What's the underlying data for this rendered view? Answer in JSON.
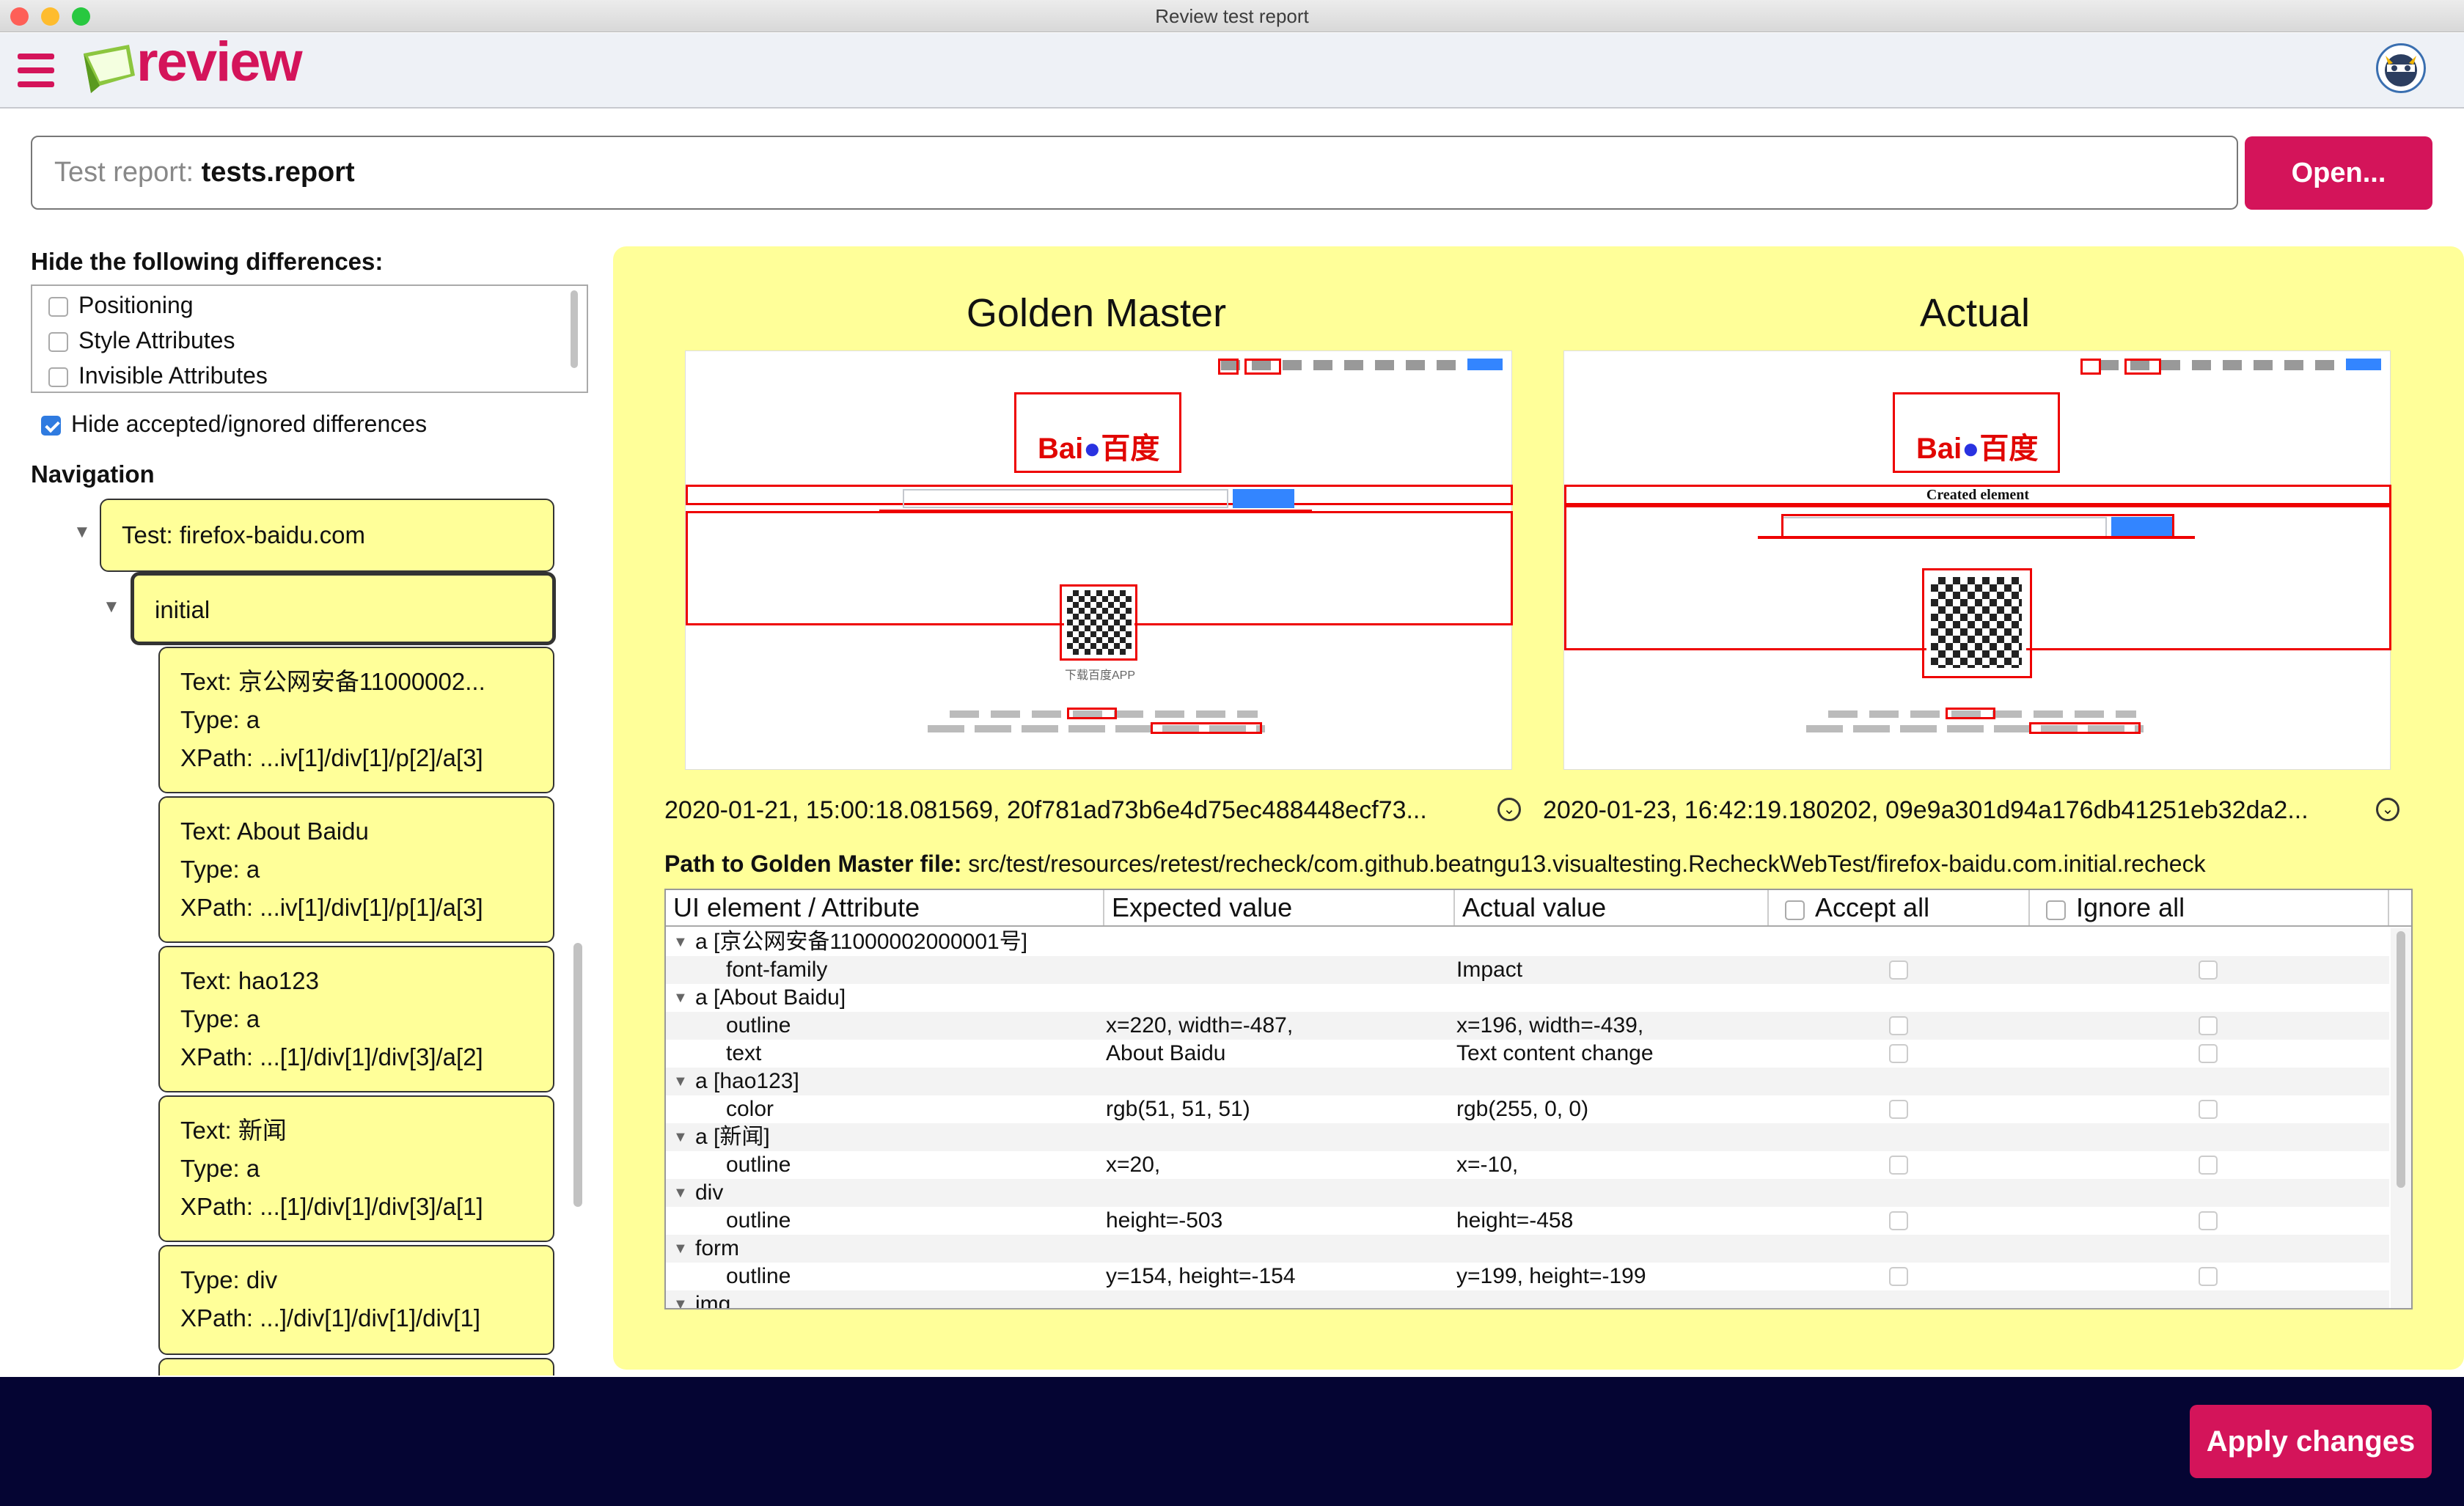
{
  "window": {
    "title": "Review test report"
  },
  "header": {
    "logo_text": "review"
  },
  "report": {
    "label": "Test report:",
    "value": "tests.report",
    "open_label": "Open..."
  },
  "filters": {
    "title": "Hide the following differences:",
    "options": [
      "Positioning",
      "Style Attributes",
      "Invisible Attributes"
    ],
    "hide_accepted_label": "Hide accepted/ignored differences",
    "hide_accepted_checked": true
  },
  "navigation": {
    "title": "Navigation",
    "test_label": "Test: firefox-baidu.com",
    "state_label": "initial",
    "items": [
      {
        "text": "Text:   京公网安备11000002...",
        "type": "Type:   a",
        "xpath": "XPath: ...iv[1]/div[1]/p[2]/a[3]"
      },
      {
        "text": "Text:   About  Baidu",
        "type": "Type:   a",
        "xpath": "XPath: ...iv[1]/div[1]/p[1]/a[3]"
      },
      {
        "text": "Text:   hao123",
        "type": "Type:   a",
        "xpath": "XPath: ...[1]/div[1]/div[3]/a[2]"
      },
      {
        "text": "Text:   新闻",
        "type": "Type:   a",
        "xpath": "XPath: ...[1]/div[1]/div[3]/a[1]"
      },
      {
        "type": "Type:   div",
        "xpath": "XPath: ...]/div[1]/div[1]/div[1]"
      }
    ]
  },
  "compare": {
    "golden_title": "Golden Master",
    "actual_title": "Actual",
    "golden_info": "2020-01-21, 15:00:18.081569, 20f781ad73b6e4d75ec488448ecf73...",
    "actual_info": "2020-01-23, 16:42:19.180202, 09e9a301d94a176db41251eb32da2...",
    "created_element_label": "Created element",
    "baidu_logo_text": "Bai",
    "baidu_logo_cn": "百度",
    "app_caption": "下载百度APP",
    "path_label": "Path to Golden Master file:",
    "path_value": "src/test/resources/retest/recheck/com.github.beatngu13.visualtesting.RecheckWebTest/firefox-baidu.com.initial.recheck"
  },
  "table": {
    "headers": {
      "element": "UI element / Attribute",
      "expected": "Expected value",
      "actual": "Actual value",
      "accept_all": "Accept all",
      "ignore_all": "Ignore all"
    },
    "rows": [
      {
        "kind": "group",
        "element": "a [京公网安备11000002000001号]"
      },
      {
        "kind": "attr",
        "element": "font-family",
        "expected": "",
        "actual": "Impact"
      },
      {
        "kind": "group",
        "element": "a [About  Baidu]"
      },
      {
        "kind": "attr",
        "element": "outline",
        "expected": "x=220, width=-487,",
        "actual": "x=196, width=-439,"
      },
      {
        "kind": "attr",
        "element": "text",
        "expected": "About  Baidu",
        "actual": "Text  content change"
      },
      {
        "kind": "group",
        "element": "a [hao123]"
      },
      {
        "kind": "attr",
        "element": "color",
        "expected": "rgb(51, 51, 51)",
        "actual": "rgb(255, 0, 0)"
      },
      {
        "kind": "group",
        "element": "a [新闻]"
      },
      {
        "kind": "attr",
        "element": "outline",
        "expected": "x=20,",
        "actual": "x=-10,"
      },
      {
        "kind": "group",
        "element": "div"
      },
      {
        "kind": "attr",
        "element": "outline",
        "expected": "height=-503",
        "actual": "height=-458"
      },
      {
        "kind": "group",
        "element": "form"
      },
      {
        "kind": "attr",
        "element": "outline",
        "expected": "y=154, height=-154",
        "actual": "y=199, height=-199"
      },
      {
        "kind": "group",
        "element": "img"
      }
    ]
  },
  "footer": {
    "apply_label": "Apply changes"
  },
  "colors": {
    "accent": "#d4145a",
    "panel": "#ffff99",
    "footer": "#050533"
  }
}
